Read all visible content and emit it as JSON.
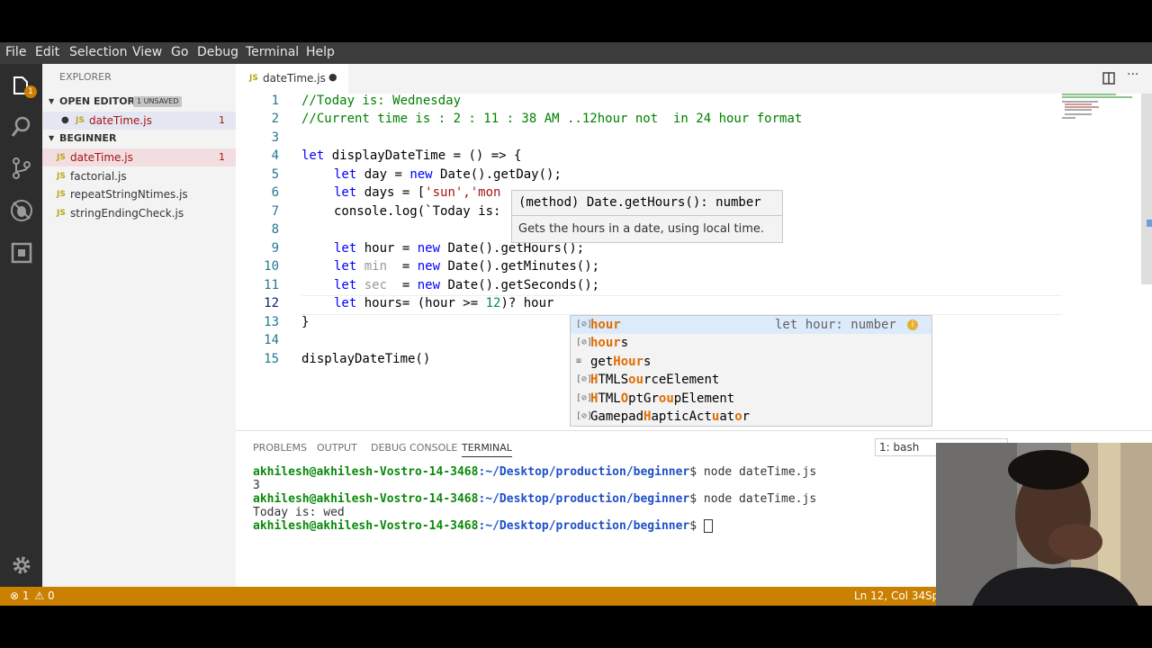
{
  "menu": [
    "File",
    "Edit",
    "Selection",
    "View",
    "Go",
    "Debug",
    "Terminal",
    "Help"
  ],
  "activity_badge": "1",
  "sidebar": {
    "title": "EXPLORER",
    "open_editors_label": "OPEN EDITORS",
    "unsaved_badge": "1 UNSAVED",
    "open_file": {
      "tag": "JS",
      "name": "dateTime.js",
      "errors": "1"
    },
    "folder_label": "BEGINNER",
    "files": [
      {
        "tag": "JS",
        "name": "dateTime.js",
        "errors": "1"
      },
      {
        "tag": "JS",
        "name": "factorial.js",
        "errors": ""
      },
      {
        "tag": "JS",
        "name": "repeatStringNtimes.js",
        "errors": ""
      },
      {
        "tag": "JS",
        "name": "stringEndingCheck.js",
        "errors": ""
      }
    ]
  },
  "tab": {
    "tag": "JS",
    "name": "dateTime.js",
    "dirty": "●"
  },
  "editor": {
    "line_numbers": [
      "1",
      "2",
      "3",
      "4",
      "5",
      "6",
      "7",
      "8",
      "9",
      "10",
      "11",
      "12",
      "13",
      "14",
      "15"
    ],
    "comment1": "//Today is: Wednesday",
    "comment2": "//Current time is : 2 : 11 : 38 AM ..12hour not  in 24 hour format",
    "l4_kw": "let",
    "l4_rest": " displayDateTime = () => {",
    "l5_kw": "let",
    "l5_mid": " day = ",
    "l5_new": "new",
    "l5_rest": " Date().getDay();",
    "l6_kw": "let",
    "l6_mid": " days = [",
    "l6_str": "'sun','mon",
    "l7_code": "console.log(`Today is:",
    "l9_kw": "let",
    "l9_mid": " hour = ",
    "l9_new": "new",
    "l9_rest": " Date().getHours();",
    "l10_kw": "let",
    "l10_var": " min ",
    "l10_mid": " = ",
    "l10_new": "new",
    "l10_rest": " Date().getMinutes();",
    "l11_kw": "let",
    "l11_var": " sec ",
    "l11_mid": " = ",
    "l11_new": "new",
    "l11_rest": " Date().getSeconds();",
    "l12_kw": "let",
    "l12_mid": " hours= (hour >= ",
    "l12_num": "12",
    "l12_rest": ")? hour",
    "l13": "}",
    "l15": "displayDateTime()"
  },
  "hover": {
    "signature": "(method) Date.getHours(): number",
    "doc": "Gets the hours in a date, using local time."
  },
  "suggest": {
    "detail": "let hour: number",
    "items": [
      {
        "icon": "variable",
        "pre": "",
        "hl": "hour",
        "post": ""
      },
      {
        "icon": "variable",
        "pre": "",
        "hl": "hour",
        "post": "s"
      },
      {
        "icon": "text",
        "pre": "get",
        "hl": "Hour",
        "post": "s"
      },
      {
        "icon": "variable",
        "pre": "",
        "hl": "H",
        "post": "TMLS",
        "hl2": "ou",
        "post2": "rceElement"
      },
      {
        "icon": "variable",
        "pre": "",
        "hl": "H",
        "post": "TML",
        "hl2": "O",
        "post2": "ptGr",
        "hl3": "ou",
        "post3": "pElement"
      },
      {
        "icon": "variable",
        "pre": "Gamepad",
        "hl": "H",
        "post": "apticAct",
        "hl2": "u",
        "post2": "at",
        "hl3": "o",
        "post3": "r"
      }
    ]
  },
  "panel": {
    "tabs": [
      "PROBLEMS",
      "OUTPUT",
      "DEBUG CONSOLE",
      "TERMINAL"
    ],
    "shell": "1: bash",
    "lines": [
      {
        "prompt": "akhilesh@akhilesh-Vostro-14-3468",
        "path": ":~/Desktop/production/beginner",
        "cmd": "$ node dateTime.js"
      },
      {
        "out": "3"
      },
      {
        "prompt": "akhilesh@akhilesh-Vostro-14-3468",
        "path": ":~/Desktop/production/beginner",
        "cmd": "$ node dateTime.js"
      },
      {
        "out": "Today is: wed"
      },
      {
        "prompt": "akhilesh@akhilesh-Vostro-14-3468",
        "path": ":~/Desktop/production/beginner",
        "cmd": "$ "
      }
    ]
  },
  "status": {
    "errors": "1",
    "warnings": "0",
    "position": "Ln 12, Col 34",
    "spaces": "Sp"
  },
  "colors": {
    "accent": "#ca8000",
    "activity": "#2d2d2d",
    "sidebar": "#f3f3f3"
  }
}
